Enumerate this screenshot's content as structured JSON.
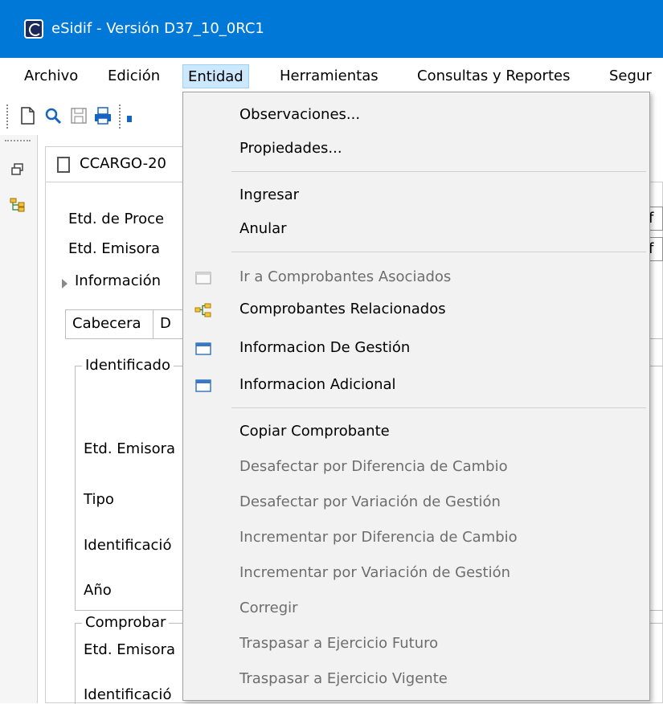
{
  "window": {
    "title": "eSidif - Versión D37_10_0RC1"
  },
  "menubar": {
    "items": [
      {
        "label": "Archivo"
      },
      {
        "label": "Edición"
      },
      {
        "label": "Entidad"
      },
      {
        "label": "Herramientas"
      },
      {
        "label": "Consultas y Reportes"
      },
      {
        "label": "Segur"
      }
    ]
  },
  "editor": {
    "tab_title": "CCARGO-20",
    "header_labels": {
      "etd_proceso": "Etd. de Proce",
      "etd_emisora": "Etd. Emisora",
      "right_cut_1": "if",
      "right_cut_2": "if"
    },
    "info_section": "Información",
    "subtabs": {
      "cabecera": "Cabecera",
      "second": "D"
    },
    "group1": {
      "title": "Identificado",
      "labels": {
        "etd_emisora": "Etd. Emisora",
        "tipo": "Tipo",
        "identificacion": "Identificació",
        "anio": "Año"
      }
    },
    "group2": {
      "title": "Comprobar",
      "labels": {
        "etd_emisora": "Etd. Emisora",
        "identificacion": "Identificació"
      }
    }
  },
  "dropdown": {
    "items": [
      {
        "label": "Observaciones...",
        "enabled": true
      },
      {
        "label": "Propiedades...",
        "enabled": true
      },
      {
        "label": "Ingresar",
        "enabled": true
      },
      {
        "label": "Anular",
        "enabled": true
      },
      {
        "label": "Ir a Comprobantes Asociados",
        "enabled": false,
        "icon": "window-icon"
      },
      {
        "label": "Comprobantes Relacionados",
        "enabled": true,
        "icon": "tree-icon"
      },
      {
        "label": "Informacion De Gestión",
        "enabled": true,
        "icon": "window-icon"
      },
      {
        "label": "Informacion Adicional",
        "enabled": true,
        "icon": "window-icon"
      },
      {
        "label": "Copiar Comprobante",
        "enabled": true
      },
      {
        "label": "Desafectar por Diferencia de Cambio",
        "enabled": false
      },
      {
        "label": "Desafectar por Variación de Gestión",
        "enabled": false
      },
      {
        "label": "Incrementar por Diferencia de Cambio",
        "enabled": false
      },
      {
        "label": "Incrementar por Variación de Gestión",
        "enabled": false
      },
      {
        "label": "Corregir",
        "enabled": false
      },
      {
        "label": "Traspasar a Ejercicio Futuro",
        "enabled": false
      },
      {
        "label": "Traspasar a Ejercicio Vigente",
        "enabled": false
      }
    ]
  },
  "colors": {
    "titlebar": "#0078d7",
    "menu_active": "#cce8ff",
    "disabled_text": "#6d6d6d"
  }
}
